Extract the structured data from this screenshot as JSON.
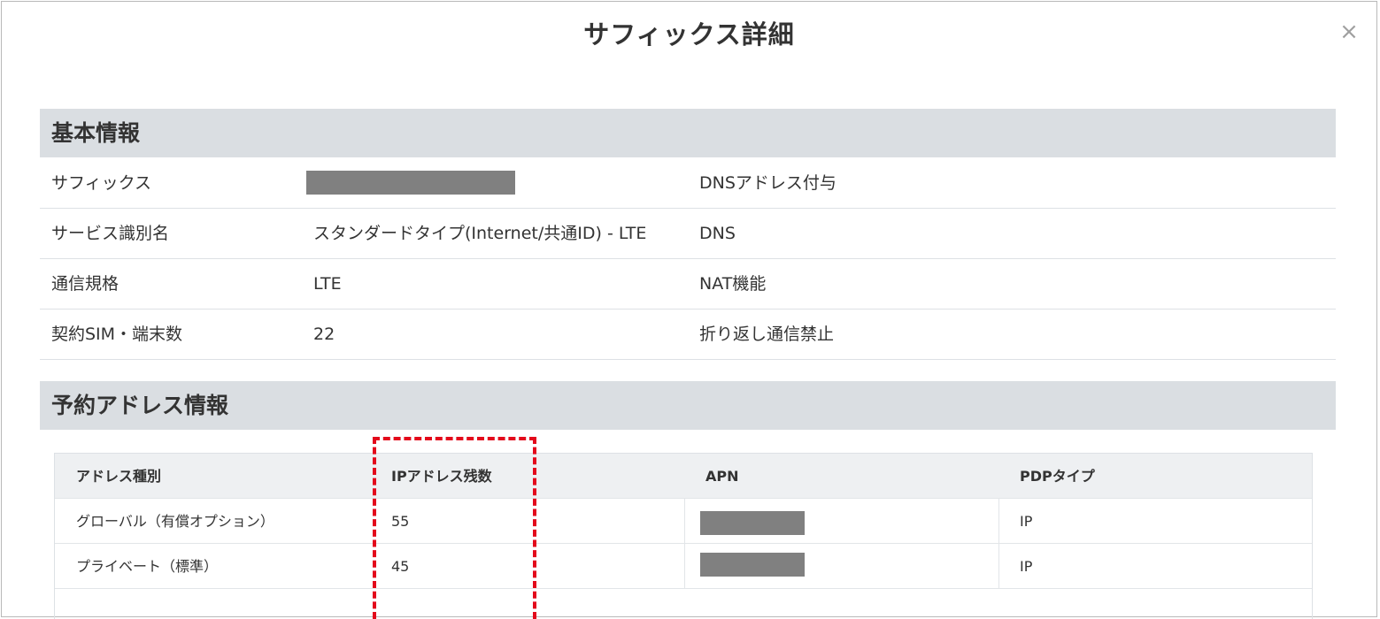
{
  "dialog": {
    "title": "サフィックス詳細",
    "close_symbol": "×"
  },
  "basic_info": {
    "header": "基本情報",
    "rows": [
      {
        "label": "サフィックス",
        "value": "",
        "value_redacted": true,
        "right_label": "DNSアドレス付与"
      },
      {
        "label": "サービス識別名",
        "value": "スタンダードタイプ(Internet/共通ID) - LTE",
        "value_redacted": false,
        "right_label": "DNS"
      },
      {
        "label": "通信規格",
        "value": "LTE",
        "value_redacted": false,
        "right_label": "NAT機能"
      },
      {
        "label": "契約SIM・端末数",
        "value": "22",
        "value_redacted": false,
        "right_label": "折り返し通信禁止"
      }
    ]
  },
  "reserved_address": {
    "header": "予約アドレス情報",
    "columns": [
      "アドレス種別",
      "IPアドレス残数",
      "APN",
      "PDPタイプ"
    ],
    "rows": [
      {
        "type": "グローバル（有償オプション）",
        "remaining": "55",
        "apn": "",
        "pdp": "IP"
      },
      {
        "type": "プライベート（標準）",
        "remaining": "45",
        "apn": "",
        "pdp": "IP"
      }
    ]
  },
  "colors": {
    "section_header_bg": "#dadee2",
    "table_header_bg": "#eef0f2",
    "highlight": "#e3091b",
    "redaction": "#808080"
  }
}
